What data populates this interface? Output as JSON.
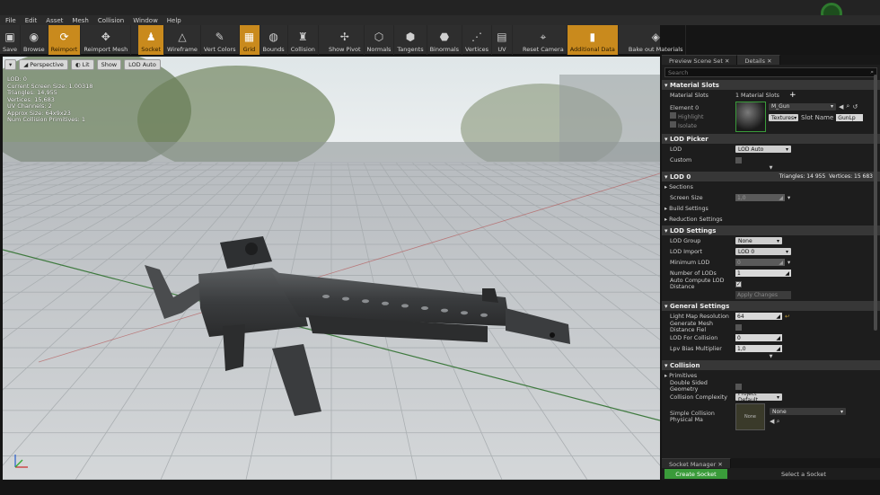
{
  "menu": [
    "File",
    "Edit",
    "Asset",
    "Mesh",
    "Collision",
    "Window",
    "Help"
  ],
  "toolbar": [
    {
      "label": "Save",
      "icon": "save-icon",
      "glyph": "▣",
      "on": false
    },
    {
      "label": "Browse",
      "icon": "browse-icon",
      "glyph": "◉",
      "on": false
    },
    {
      "label": "Reimport",
      "icon": "reimport-icon",
      "glyph": "⟳",
      "on": true
    },
    {
      "label": "Reimport Mesh",
      "icon": "reimport-mesh-icon",
      "glyph": "✥",
      "on": false
    },
    {
      "label": "Socket",
      "icon": "socket-icon",
      "glyph": "♟",
      "on": true
    },
    {
      "label": "Wireframe",
      "icon": "wireframe-icon",
      "glyph": "△",
      "on": false
    },
    {
      "label": "Vert Colors",
      "icon": "vert-colors-icon",
      "glyph": "✎",
      "on": false
    },
    {
      "label": "Grid",
      "icon": "grid-icon",
      "glyph": "▦",
      "on": true
    },
    {
      "label": "Bounds",
      "icon": "bounds-icon",
      "glyph": "◍",
      "on": false
    },
    {
      "label": "Collision",
      "icon": "collision-icon",
      "glyph": "♜",
      "on": false
    },
    {
      "label": "Show Pivot",
      "icon": "pivot-icon",
      "glyph": "✢",
      "on": false
    },
    {
      "label": "Normals",
      "icon": "normals-icon",
      "glyph": "⬡",
      "on": false
    },
    {
      "label": "Tangents",
      "icon": "tangents-icon",
      "glyph": "⬢",
      "on": false
    },
    {
      "label": "Binormals",
      "icon": "binormals-icon",
      "glyph": "⬣",
      "on": false
    },
    {
      "label": "Vertices",
      "icon": "vertices-icon",
      "glyph": "⋰",
      "on": false
    },
    {
      "label": "UV",
      "icon": "uv-icon",
      "glyph": "▤",
      "on": false
    },
    {
      "label": "Reset Camera",
      "icon": "camera-icon",
      "glyph": "⌖",
      "on": false
    },
    {
      "label": "Additional Data",
      "icon": "additional-data-icon",
      "glyph": "▮",
      "on": true
    },
    {
      "label": "Bake out Materials",
      "icon": "bake-icon",
      "glyph": "◈",
      "on": false
    }
  ],
  "viewport": {
    "controls": [
      "Perspective",
      "Lit",
      "Show",
      "LOD Auto"
    ],
    "stats": [
      "LOD: 0",
      "Current Screen Size: 1.00318",
      "Triangles: 14,955",
      "Vertices: 15,683",
      "UV Channels: 2",
      "Approx Size: 64x9x23",
      "Num Collision Primitives: 1"
    ]
  },
  "panel": {
    "tabs": [
      "Preview Scene Set",
      "Details"
    ],
    "search_placeholder": "Search",
    "material_slots": {
      "title": "Material Slots",
      "label": "Material Slots",
      "count": "1 Material Slots",
      "element": "Element 0",
      "highlight": "Highlight",
      "isolate": "Isolate",
      "material_name": "M_Gun",
      "textures": "Textures",
      "slot_name_label": "Slot Name",
      "slot_name": "GunLp"
    },
    "lod_picker": {
      "title": "LOD Picker",
      "lod_label": "LOD",
      "lod_value": "LOD Auto",
      "custom_label": "Custom"
    },
    "lod0": {
      "title": "LOD 0",
      "triangles": "Triangles: 14 955",
      "vertices": "Vertices: 15 683",
      "sections": "Sections",
      "screen_size_label": "Screen Size",
      "screen_size": "1,0",
      "build_settings": "Build Settings",
      "reduction_settings": "Reduction Settings"
    },
    "lod_settings": {
      "title": "LOD Settings",
      "lod_group_label": "LOD Group",
      "lod_group": "None",
      "lod_import_label": "LOD Import",
      "lod_import": "LOD 0",
      "min_lod_label": "Minimum LOD",
      "min_lod": "0",
      "num_lods_label": "Number of LODs",
      "num_lods": "1",
      "auto_compute_label": "Auto Compute LOD Distance",
      "apply_changes": "Apply Changes"
    },
    "general": {
      "title": "General Settings",
      "lightmap_label": "Light Map Resolution",
      "lightmap": "64",
      "distance_field_label": "Generate Mesh Distance Fiel",
      "lod_collision_label": "LOD For Collision",
      "lod_collision": "0",
      "lpv_label": "Lpv Bias Multiplier",
      "lpv": "1,0"
    },
    "collision": {
      "title": "Collision",
      "primitives": "Primitives",
      "double_sided_label": "Double Sided Geometry",
      "complexity_label": "Collision Complexity",
      "complexity": "Project Default",
      "simple_phys_label": "Simple Collision Physical Ma",
      "none_thumb": "None",
      "phys_value": "None"
    }
  },
  "socket_manager": {
    "tab": "Socket Manager",
    "create": "Create Socket",
    "select": "Select a Socket"
  }
}
